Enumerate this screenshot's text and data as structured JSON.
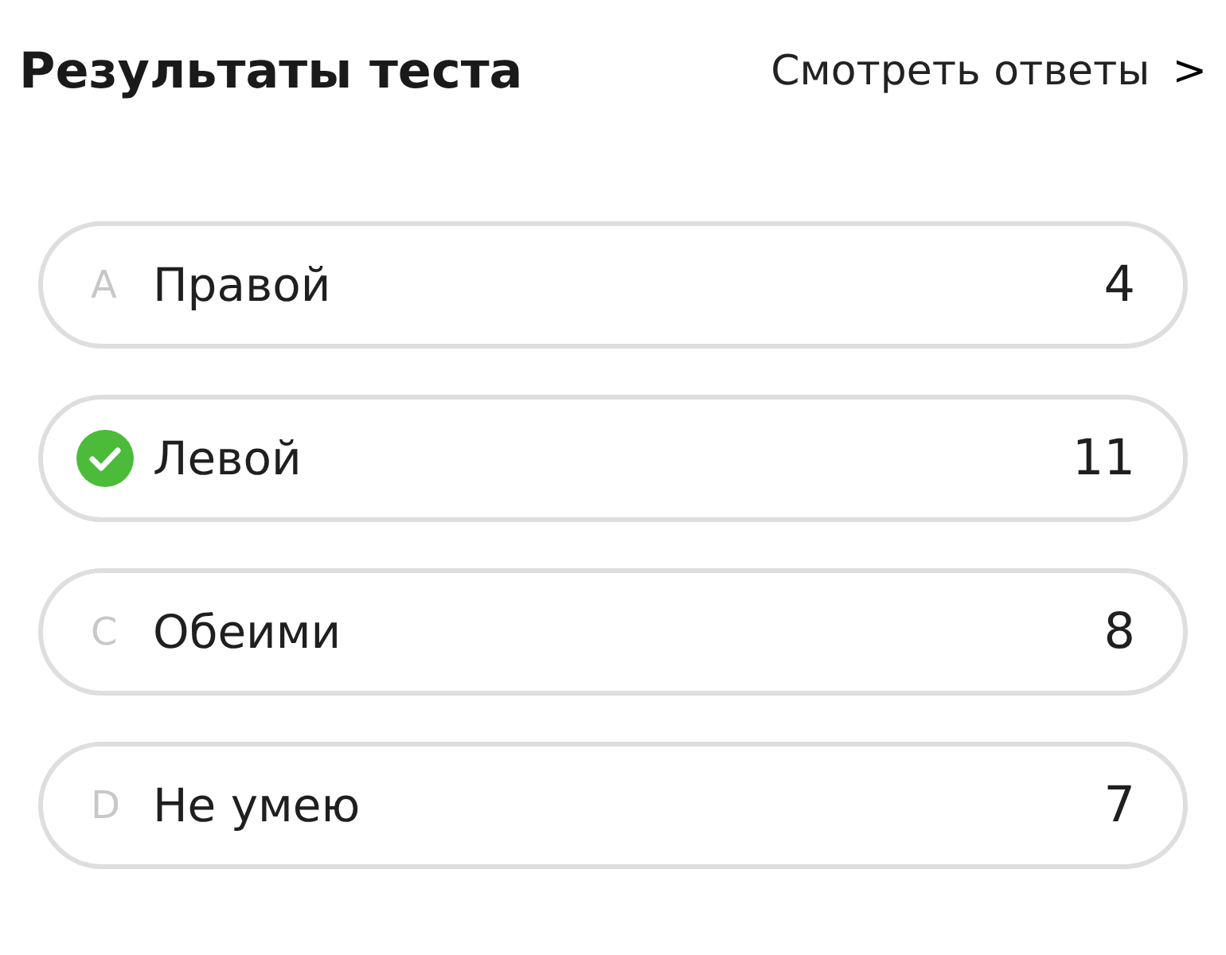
{
  "header": {
    "title": "Результаты теста",
    "link": "Смотреть ответы",
    "link_arrow": ">"
  },
  "options": [
    {
      "letter": "A",
      "label": "Правой",
      "count": "4",
      "correct": false
    },
    {
      "label": "Левой",
      "count": "11",
      "correct": true
    },
    {
      "letter": "C",
      "label": "Обеими",
      "count": "8",
      "correct": false
    },
    {
      "letter": "D",
      "label": "Не умею",
      "count": "7",
      "correct": false
    }
  ]
}
